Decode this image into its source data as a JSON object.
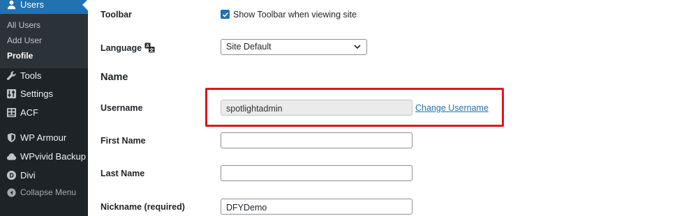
{
  "sidebar": {
    "users_label": "Users",
    "submenu": [
      {
        "label": "All Users"
      },
      {
        "label": "Add User"
      },
      {
        "label": "Profile"
      }
    ],
    "items": [
      {
        "label": "Tools",
        "icon": "wrench-icon"
      },
      {
        "label": "Settings",
        "icon": "sliders-icon"
      },
      {
        "label": "ACF",
        "icon": "grid-icon"
      },
      {
        "label": "WP Armour",
        "icon": "shield-icon"
      },
      {
        "label": "WPvivid Backup",
        "icon": "cloud-icon"
      },
      {
        "label": "Divi",
        "icon": "divi-d-icon"
      }
    ],
    "collapse_label": "Collapse Menu"
  },
  "form": {
    "toolbar": {
      "label": "Toolbar",
      "checkbox_label": "Show Toolbar when viewing site",
      "checked": true
    },
    "language": {
      "label": "Language",
      "value": "Site Default"
    },
    "section_title": "Name",
    "username": {
      "label": "Username",
      "value": "spotlightadmin",
      "change_link": "Change Username"
    },
    "first_name": {
      "label": "First Name",
      "value": ""
    },
    "last_name": {
      "label": "Last Name",
      "value": ""
    },
    "nickname": {
      "label": "Nickname (required)",
      "value": "DFYDemo"
    }
  },
  "colors": {
    "sidebar_bg": "#1d2327",
    "accent": "#2271b1",
    "highlight": "#e0151e"
  }
}
